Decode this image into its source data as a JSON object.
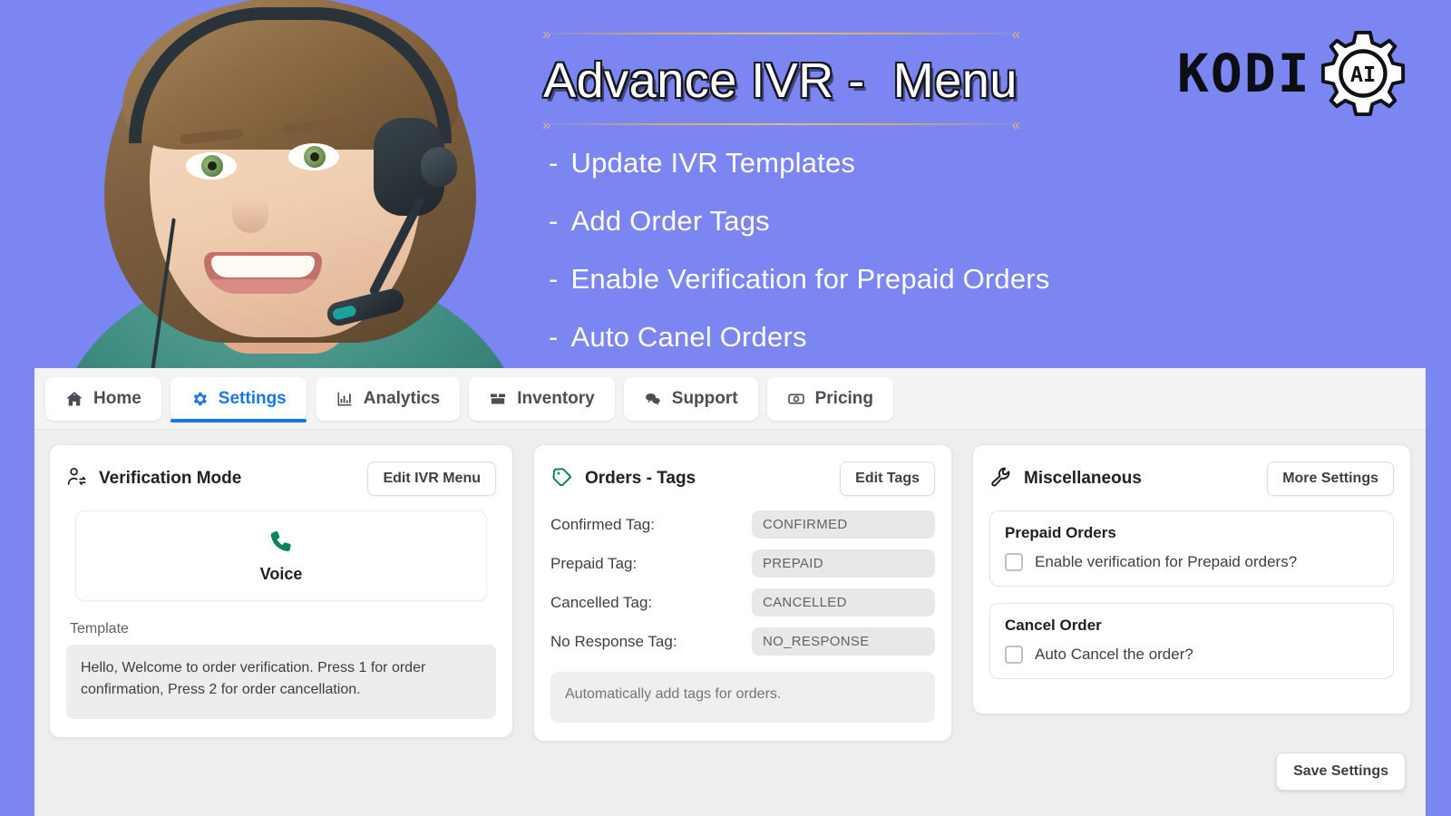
{
  "hero": {
    "title": "Advance IVR -  Menu",
    "ornament_chevron_left": "»",
    "ornament_chevron_right": "«",
    "bullet_marker": "-",
    "bullets": [
      "Update IVR Templates",
      "Add Order Tags",
      "Enable Verification for Prepaid Orders",
      "Auto Canel Orders"
    ],
    "logo": {
      "wordmark": "KODI",
      "gear_text": "AI",
      "icon": "gear-ai-icon"
    },
    "photo_alt": "call-center-agent-headset-photo",
    "background_color": "#7b86f2"
  },
  "tabs": [
    {
      "label": "Home",
      "icon": "home-icon",
      "active": false
    },
    {
      "label": "Settings",
      "icon": "gear-icon",
      "active": true
    },
    {
      "label": "Analytics",
      "icon": "bar-chart-icon",
      "active": false
    },
    {
      "label": "Inventory",
      "icon": "box-icon",
      "active": false
    },
    {
      "label": "Support",
      "icon": "chat-icon",
      "active": false
    },
    {
      "label": "Pricing",
      "icon": "money-bill-icon",
      "active": false
    }
  ],
  "verification_card": {
    "title": "Verification Mode",
    "icon": "user-switch-icon",
    "button_label": "Edit IVR Menu",
    "mode": {
      "icon": "phone-icon",
      "icon_color": "#0b8457",
      "label": "Voice"
    },
    "template_label": "Template",
    "template_text": "Hello, Welcome to order verification. Press 1 for order confirmation, Press 2 for order cancellation."
  },
  "tags_card": {
    "title": "Orders - Tags",
    "icon": "tag-icon",
    "icon_color": "#0b8457",
    "button_label": "Edit Tags",
    "rows": [
      {
        "key": "Confirmed Tag:",
        "value": "CONFIRMED"
      },
      {
        "key": "Prepaid Tag:",
        "value": "PREPAID"
      },
      {
        "key": "Cancelled Tag:",
        "value": "CANCELLED"
      },
      {
        "key": "No Response Tag:",
        "value": "NO_RESPONSE"
      }
    ],
    "note": "Automatically add tags for orders."
  },
  "misc_card": {
    "title": "Miscellaneous",
    "icon": "wrench-icon",
    "button_label": "More Settings",
    "panels": [
      {
        "title": "Prepaid Orders",
        "checkbox_label": "Enable verification for Prepaid orders?",
        "checked": false
      },
      {
        "title": "Cancel Order",
        "checkbox_label": "Auto Cancel the order?",
        "checked": false
      }
    ]
  },
  "footer": {
    "save_label": "Save Settings"
  },
  "colors": {
    "hero_bg": "#7b86f2",
    "accent_blue": "#1877e8",
    "accent_green": "#0b8457",
    "ornament_gold": "#d0b278",
    "app_bg": "#eeeeee"
  }
}
